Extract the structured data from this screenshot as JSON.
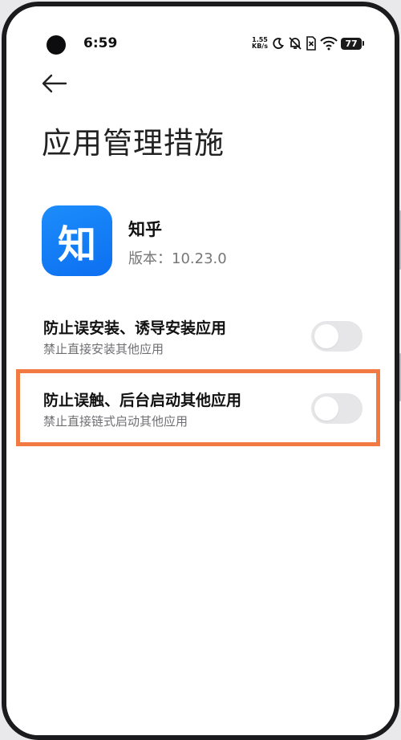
{
  "status_bar": {
    "time": "6:59",
    "net_speed_value": "1.55",
    "net_speed_unit": "KB/s",
    "battery": "77"
  },
  "header": {
    "back_icon": "arrow-left-icon",
    "title": "应用管理措施"
  },
  "app": {
    "icon_text": "知",
    "name": "知乎",
    "version": "版本：10.23.0",
    "icon_color": "#1482f5"
  },
  "settings": [
    {
      "title": "防止误安装、诱导安装应用",
      "subtitle": "禁止直接安装其他应用",
      "enabled": false
    },
    {
      "title": "防止误触、后台启动其他应用",
      "subtitle": "禁止直接链式启动其他应用",
      "enabled": false
    }
  ],
  "colors": {
    "highlight": "#f07a42",
    "toggle_off": "#e6e6e8"
  }
}
